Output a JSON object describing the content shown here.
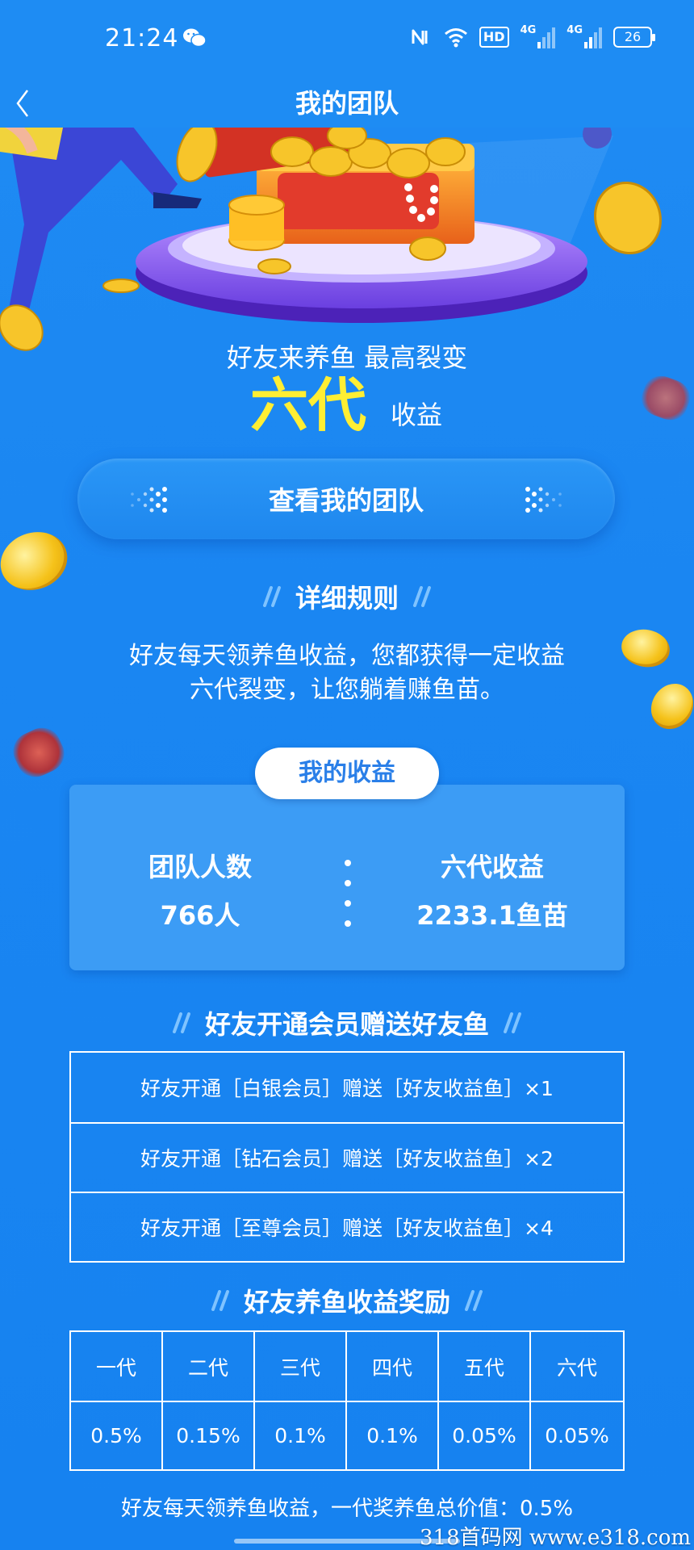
{
  "status_bar": {
    "time": "21:24",
    "network_badge": "HD",
    "signal_1": "4G",
    "signal_2": "4G",
    "battery": "26"
  },
  "nav": {
    "title": "我的团队",
    "back_icon": "chevron-left-icon"
  },
  "hero": {
    "line1": "好友来养鱼  最高裂变",
    "big": "六代",
    "suffix": "收益"
  },
  "view_team_button": "查看我的团队",
  "rules": {
    "heading": "详细规则",
    "line1": "好友每天领养鱼收益，您都获得一定收益",
    "line2": "六代裂变，让您躺着赚鱼苗。"
  },
  "earnings": {
    "tab_label": "我的收益",
    "team_count_label": "团队人数",
    "team_count_value": "766人",
    "six_gen_label": "六代收益",
    "six_gen_value": "2233.1鱼苗"
  },
  "gift_section": {
    "heading": "好友开通会员赠送好友鱼",
    "rows": [
      "好友开通［白银会员］赠送［好友收益鱼］×1",
      "好友开通［钻石会员］赠送［好友收益鱼］×2",
      "好友开通［至尊会员］赠送［好友收益鱼］×4"
    ]
  },
  "reward_section": {
    "heading": "好友养鱼收益奖励",
    "generations": [
      "一代",
      "二代",
      "三代",
      "四代",
      "五代",
      "六代"
    ],
    "rates": [
      "0.5%",
      "0.15%",
      "0.1%",
      "0.1%",
      "0.05%",
      "0.05%"
    ]
  },
  "footer_note": "好友每天领养鱼收益，一代奖养鱼总价值：0.5%",
  "watermark": "318首码网  www.e318.com",
  "colors": {
    "background": "#1a86f2",
    "accent_yellow": "#ffee33",
    "tab_text": "#2a7fe8"
  }
}
